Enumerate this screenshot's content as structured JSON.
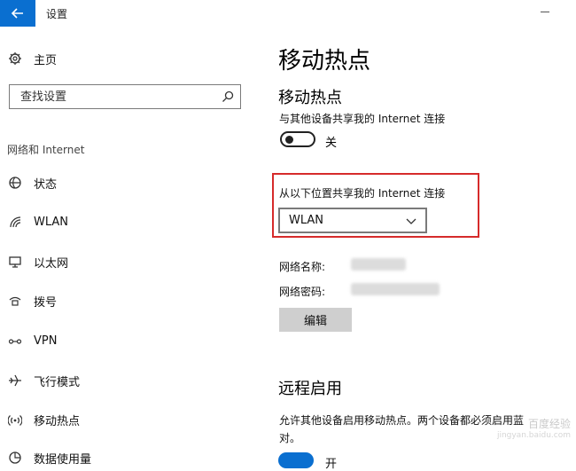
{
  "window": {
    "title": "设置"
  },
  "sidebar": {
    "home_label": "主页",
    "search_placeholder": "查找设置",
    "section_label": "网络和 Internet",
    "items": [
      {
        "label": "状态",
        "icon": "globe-icon"
      },
      {
        "label": "WLAN",
        "icon": "wifi-icon"
      },
      {
        "label": "以太网",
        "icon": "ethernet-icon"
      },
      {
        "label": "拨号",
        "icon": "dialup-icon"
      },
      {
        "label": "VPN",
        "icon": "vpn-icon"
      },
      {
        "label": "飞行模式",
        "icon": "airplane-icon"
      },
      {
        "label": "移动热点",
        "icon": "hotspot-icon"
      },
      {
        "label": "数据使用量",
        "icon": "data-usage-icon"
      }
    ]
  },
  "main": {
    "page_title": "移动热点",
    "hotspot_heading": "移动热点",
    "hotspot_desc": "与其他设备共享我的 Internet 连接",
    "toggle_label": "关",
    "share_from_label": "从以下位置共享我的 Internet 连接",
    "share_from_value": "WLAN",
    "network_name_label": "网络名称:",
    "network_password_label": "网络密码:",
    "edit_button": "编辑",
    "remote_heading": "远程启用",
    "remote_desc_line1": "允许其他设备启用移动热点。两个设备都必须启用蓝",
    "remote_desc_line2": "对。",
    "remote_toggle_label": "开"
  },
  "watermark": {
    "main": "百度经验",
    "sub": "jingyan.baidu.com"
  },
  "colors": {
    "accent": "#0a6fd0",
    "highlight_border": "#d62b2b"
  }
}
